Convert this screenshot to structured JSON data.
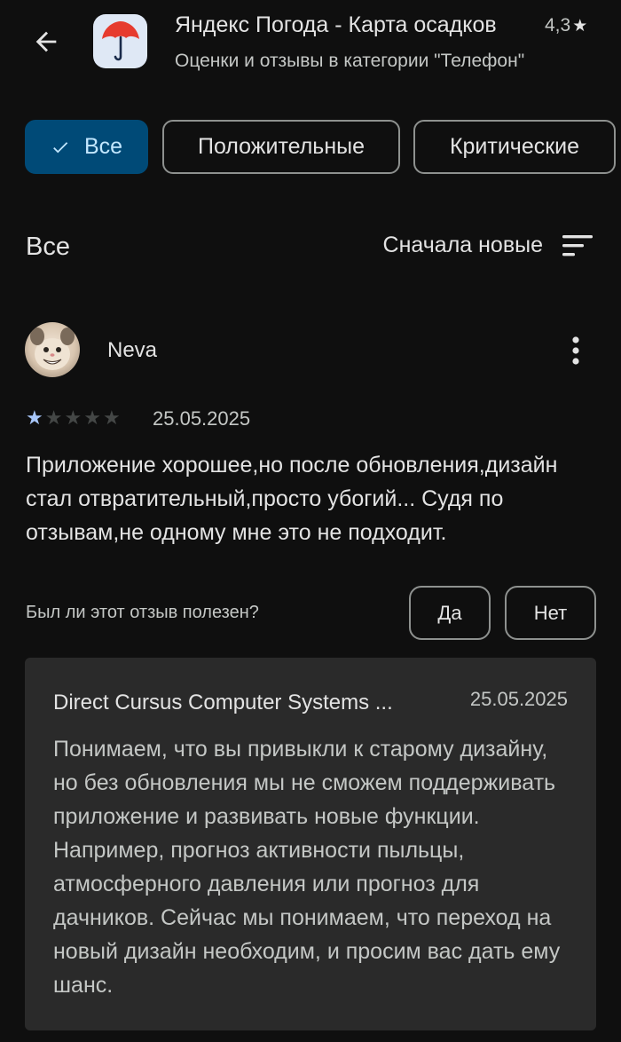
{
  "header": {
    "back_icon": "arrow-left-icon",
    "app_icon": "umbrella-icon",
    "app_title": "Яндекс Погода - Карта осадков",
    "rating": "4,3",
    "rating_icon": "star-icon",
    "subtitle": "Оценки и отзывы в категории \"Телефон\""
  },
  "filters": {
    "selected": "Все",
    "chips": [
      "Все",
      "Положительные",
      "Критические"
    ]
  },
  "section": {
    "title": "Все",
    "sort_label": "Сначала новые",
    "sort_icon": "sort-icon"
  },
  "review": {
    "author": "Neva",
    "rating": 1,
    "max_rating": 5,
    "date": "25.05.2025",
    "text": "Приложение хорошее,но после обновления,дизайн стал отвратительный,просто убогий... Судя по отзывам,не одному мне это не подходит.",
    "helpful_question": "Был ли этот отзыв полезен?",
    "yes_label": "Да",
    "no_label": "Нет",
    "more_icon": "more-vert-icon"
  },
  "reply": {
    "developer": "Direct Cursus Computer Systems ...",
    "date": "25.05.2025",
    "text": "Понимаем, что вы привыкли к старому дизайну, но без обновления мы не сможем поддерживать приложение и развивать новые функции. Например, прогноз активности пыльцы, атмосферного давления или прогноз для дачников. Сейчас мы понимаем, что переход на новый дизайн необходим, и просим вас дать ему шанс."
  },
  "colors": {
    "background": "#0f0f0f",
    "chip_selected_bg": "#004a77",
    "chip_selected_text": "#c2e7ff",
    "star_filled": "#a8c7fa",
    "reply_card_bg": "#2a2a2a",
    "umbrella": "#e63b2e"
  }
}
